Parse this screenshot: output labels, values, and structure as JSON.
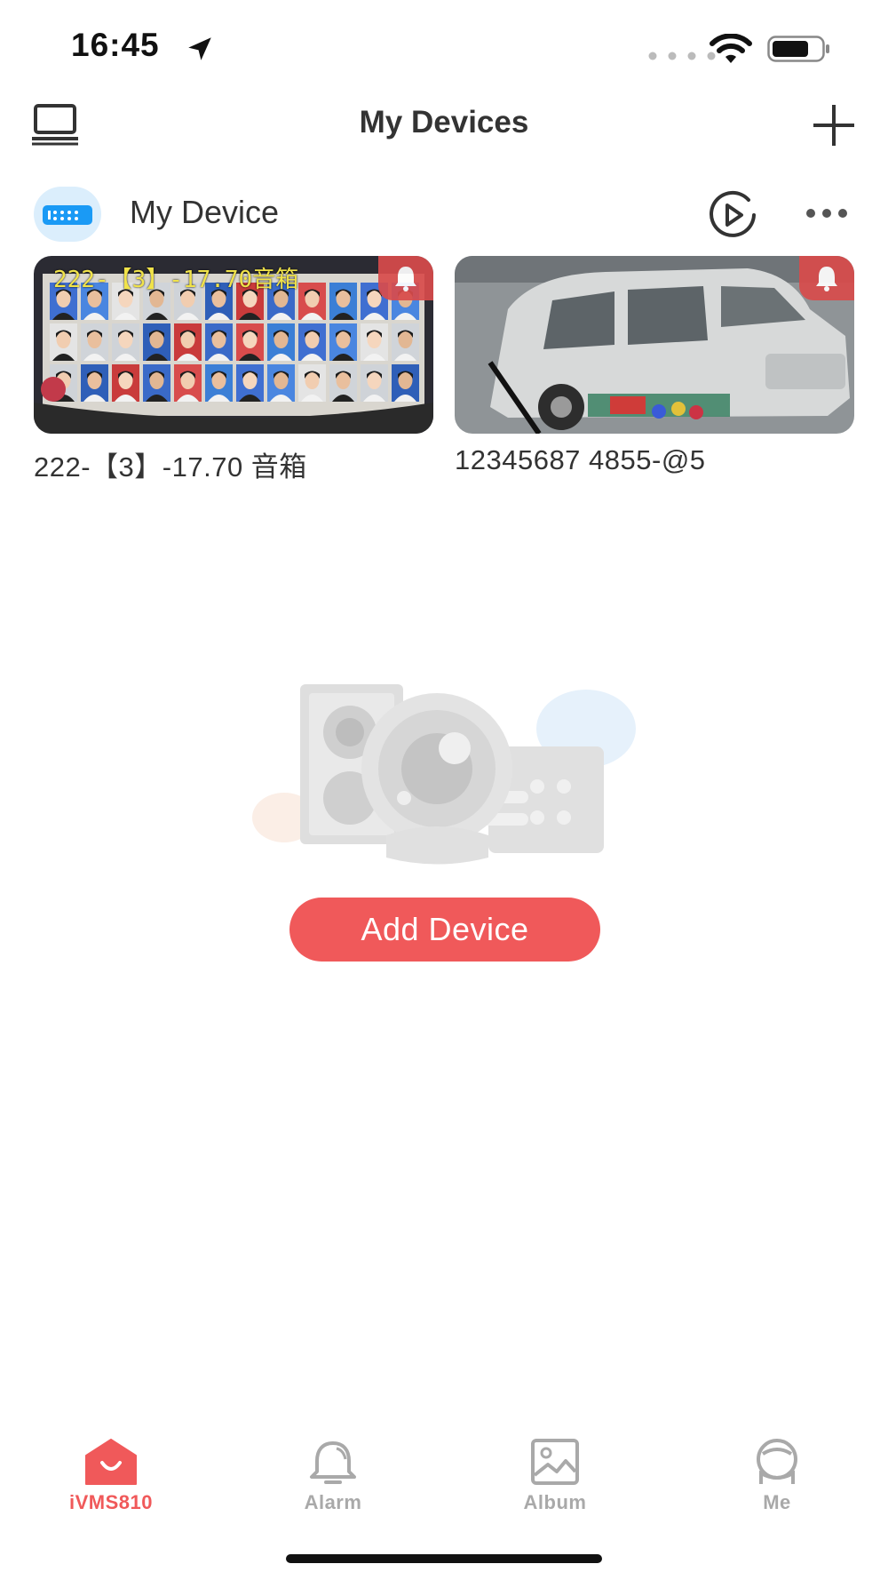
{
  "status_bar": {
    "time": "16:45",
    "icons": [
      "location-arrow-icon",
      "cellular-signal-icon",
      "wifi-icon",
      "battery-icon"
    ]
  },
  "nav": {
    "title": "My Devices",
    "left_icon": "device-list-icon",
    "right_icon": "plus-icon"
  },
  "group": {
    "name": "My Device",
    "icons": [
      "nvr-icon",
      "play-circle-icon",
      "more-dots-icon"
    ]
  },
  "devices": [
    {
      "name": "222-【3】-17.70 音箱",
      "osd_text": "222-【3】-17.70音箱",
      "icon": "alarm-bell-icon"
    },
    {
      "name": "12345687  4855-@5",
      "icon": "alarm-bell-icon"
    }
  ],
  "empty_state": {
    "button_label": "Add Device",
    "illustration": "devices-illustration"
  },
  "tabs": [
    {
      "label": "iVMS810",
      "icon": "home-icon",
      "active": true
    },
    {
      "label": "Alarm",
      "icon": "bell-icon",
      "active": false
    },
    {
      "label": "Album",
      "icon": "image-icon",
      "active": false
    },
    {
      "label": "Me",
      "icon": "user-icon",
      "active": false
    }
  ],
  "colors": {
    "accent": "#f0595a",
    "tab_inactive": "#a9a9a9",
    "avatar_bg": "#dbeefc",
    "avatar_blue": "#1a9af5"
  }
}
